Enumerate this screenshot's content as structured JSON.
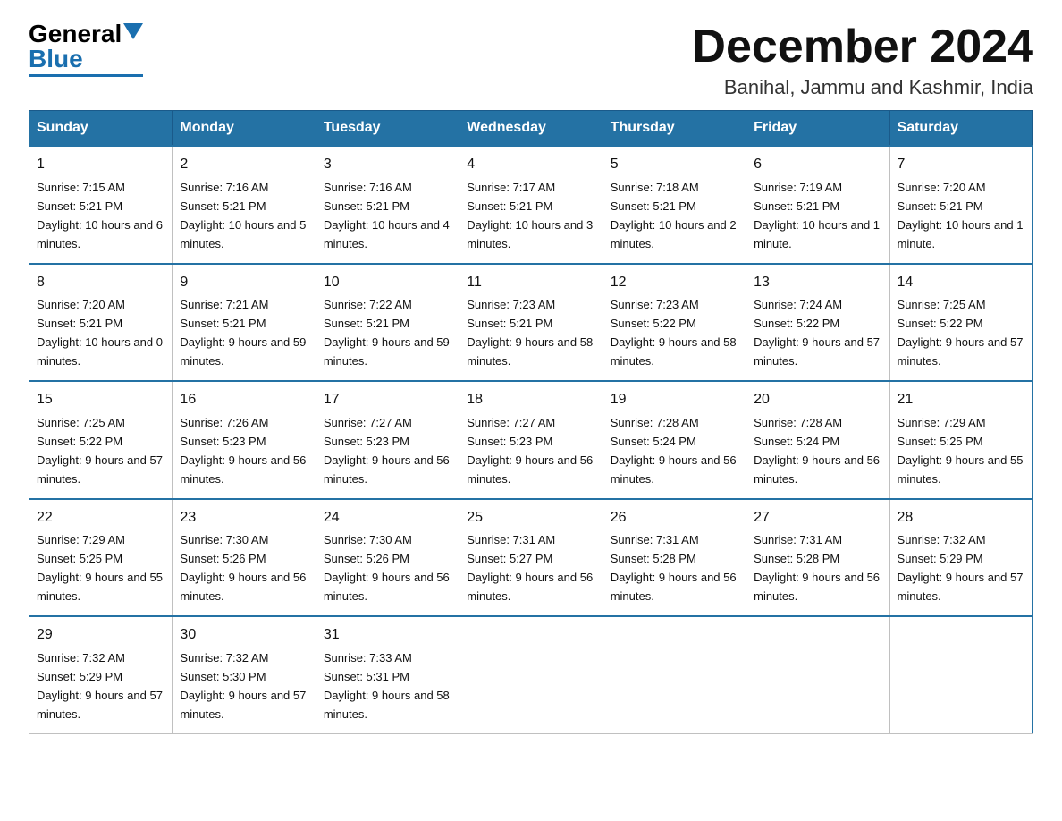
{
  "header": {
    "logo_general": "General",
    "logo_blue": "Blue",
    "month_title": "December 2024",
    "location": "Banihal, Jammu and Kashmir, India"
  },
  "days_of_week": [
    "Sunday",
    "Monday",
    "Tuesday",
    "Wednesday",
    "Thursday",
    "Friday",
    "Saturday"
  ],
  "weeks": [
    [
      {
        "day": "1",
        "sunrise": "7:15 AM",
        "sunset": "5:21 PM",
        "daylight": "10 hours and 6 minutes."
      },
      {
        "day": "2",
        "sunrise": "7:16 AM",
        "sunset": "5:21 PM",
        "daylight": "10 hours and 5 minutes."
      },
      {
        "day": "3",
        "sunrise": "7:16 AM",
        "sunset": "5:21 PM",
        "daylight": "10 hours and 4 minutes."
      },
      {
        "day": "4",
        "sunrise": "7:17 AM",
        "sunset": "5:21 PM",
        "daylight": "10 hours and 3 minutes."
      },
      {
        "day": "5",
        "sunrise": "7:18 AM",
        "sunset": "5:21 PM",
        "daylight": "10 hours and 2 minutes."
      },
      {
        "day": "6",
        "sunrise": "7:19 AM",
        "sunset": "5:21 PM",
        "daylight": "10 hours and 1 minute."
      },
      {
        "day": "7",
        "sunrise": "7:20 AM",
        "sunset": "5:21 PM",
        "daylight": "10 hours and 1 minute."
      }
    ],
    [
      {
        "day": "8",
        "sunrise": "7:20 AM",
        "sunset": "5:21 PM",
        "daylight": "10 hours and 0 minutes."
      },
      {
        "day": "9",
        "sunrise": "7:21 AM",
        "sunset": "5:21 PM",
        "daylight": "9 hours and 59 minutes."
      },
      {
        "day": "10",
        "sunrise": "7:22 AM",
        "sunset": "5:21 PM",
        "daylight": "9 hours and 59 minutes."
      },
      {
        "day": "11",
        "sunrise": "7:23 AM",
        "sunset": "5:21 PM",
        "daylight": "9 hours and 58 minutes."
      },
      {
        "day": "12",
        "sunrise": "7:23 AM",
        "sunset": "5:22 PM",
        "daylight": "9 hours and 58 minutes."
      },
      {
        "day": "13",
        "sunrise": "7:24 AM",
        "sunset": "5:22 PM",
        "daylight": "9 hours and 57 minutes."
      },
      {
        "day": "14",
        "sunrise": "7:25 AM",
        "sunset": "5:22 PM",
        "daylight": "9 hours and 57 minutes."
      }
    ],
    [
      {
        "day": "15",
        "sunrise": "7:25 AM",
        "sunset": "5:22 PM",
        "daylight": "9 hours and 57 minutes."
      },
      {
        "day": "16",
        "sunrise": "7:26 AM",
        "sunset": "5:23 PM",
        "daylight": "9 hours and 56 minutes."
      },
      {
        "day": "17",
        "sunrise": "7:27 AM",
        "sunset": "5:23 PM",
        "daylight": "9 hours and 56 minutes."
      },
      {
        "day": "18",
        "sunrise": "7:27 AM",
        "sunset": "5:23 PM",
        "daylight": "9 hours and 56 minutes."
      },
      {
        "day": "19",
        "sunrise": "7:28 AM",
        "sunset": "5:24 PM",
        "daylight": "9 hours and 56 minutes."
      },
      {
        "day": "20",
        "sunrise": "7:28 AM",
        "sunset": "5:24 PM",
        "daylight": "9 hours and 56 minutes."
      },
      {
        "day": "21",
        "sunrise": "7:29 AM",
        "sunset": "5:25 PM",
        "daylight": "9 hours and 55 minutes."
      }
    ],
    [
      {
        "day": "22",
        "sunrise": "7:29 AM",
        "sunset": "5:25 PM",
        "daylight": "9 hours and 55 minutes."
      },
      {
        "day": "23",
        "sunrise": "7:30 AM",
        "sunset": "5:26 PM",
        "daylight": "9 hours and 56 minutes."
      },
      {
        "day": "24",
        "sunrise": "7:30 AM",
        "sunset": "5:26 PM",
        "daylight": "9 hours and 56 minutes."
      },
      {
        "day": "25",
        "sunrise": "7:31 AM",
        "sunset": "5:27 PM",
        "daylight": "9 hours and 56 minutes."
      },
      {
        "day": "26",
        "sunrise": "7:31 AM",
        "sunset": "5:28 PM",
        "daylight": "9 hours and 56 minutes."
      },
      {
        "day": "27",
        "sunrise": "7:31 AM",
        "sunset": "5:28 PM",
        "daylight": "9 hours and 56 minutes."
      },
      {
        "day": "28",
        "sunrise": "7:32 AM",
        "sunset": "5:29 PM",
        "daylight": "9 hours and 57 minutes."
      }
    ],
    [
      {
        "day": "29",
        "sunrise": "7:32 AM",
        "sunset": "5:29 PM",
        "daylight": "9 hours and 57 minutes."
      },
      {
        "day": "30",
        "sunrise": "7:32 AM",
        "sunset": "5:30 PM",
        "daylight": "9 hours and 57 minutes."
      },
      {
        "day": "31",
        "sunrise": "7:33 AM",
        "sunset": "5:31 PM",
        "daylight": "9 hours and 58 minutes."
      },
      {
        "day": "",
        "sunrise": "",
        "sunset": "",
        "daylight": ""
      },
      {
        "day": "",
        "sunrise": "",
        "sunset": "",
        "daylight": ""
      },
      {
        "day": "",
        "sunrise": "",
        "sunset": "",
        "daylight": ""
      },
      {
        "day": "",
        "sunrise": "",
        "sunset": "",
        "daylight": ""
      }
    ]
  ],
  "labels": {
    "sunrise": "Sunrise:",
    "sunset": "Sunset:",
    "daylight": "Daylight:"
  }
}
